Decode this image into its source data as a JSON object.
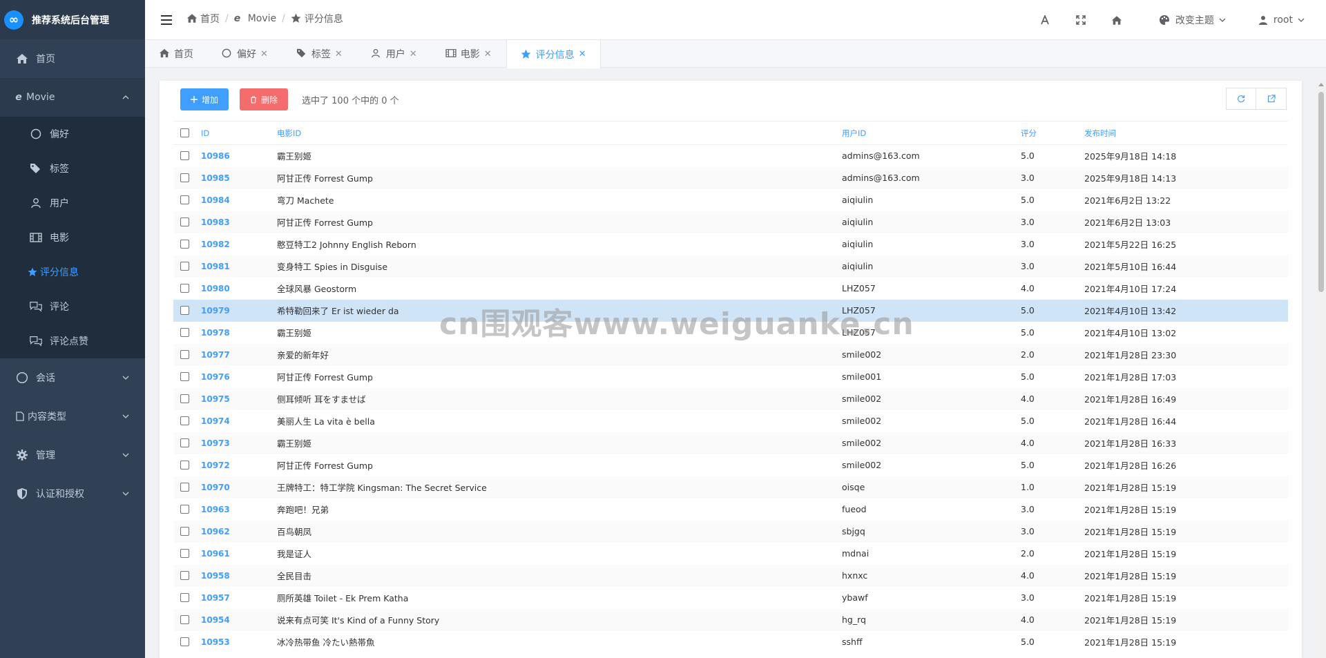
{
  "app": {
    "title": "推荐系统后台管理"
  },
  "sidebar": {
    "home": "首页",
    "movie": "Movie",
    "movie_items": [
      "偏好",
      "标签",
      "用户",
      "电影",
      "评分信息",
      "评论",
      "评论点赞"
    ],
    "session": "会话",
    "content_type": "内容类型",
    "manage": "管理",
    "auth": "认证和授权"
  },
  "header": {
    "breadcrumb": [
      "首页",
      "Movie",
      "评分信息"
    ],
    "theme": "改变主题",
    "user": "root"
  },
  "tabs": [
    "首页",
    "偏好",
    "标签",
    "用户",
    "电影",
    "评分信息"
  ],
  "toolbar": {
    "add": "增加",
    "delete": "删除",
    "selection": "选中了 100 个中的 0 个"
  },
  "table": {
    "headers": [
      "ID",
      "电影ID",
      "用户ID",
      "评分",
      "发布时间"
    ],
    "rows": [
      [
        "10986",
        "霸王别姬",
        "admins@163.com",
        "5.0",
        "2025年9月18日 14:18"
      ],
      [
        "10985",
        "阿甘正传 Forrest Gump",
        "admins@163.com",
        "3.0",
        "2025年9月18日 14:13"
      ],
      [
        "10984",
        "弯刀 Machete",
        "aiqiulin",
        "5.0",
        "2021年6月2日 13:22"
      ],
      [
        "10983",
        "阿甘正传 Forrest Gump",
        "aiqiulin",
        "3.0",
        "2021年6月2日 13:03"
      ],
      [
        "10982",
        "憨豆特工2 Johnny English Reborn",
        "aiqiulin",
        "3.0",
        "2021年5月22日 16:25"
      ],
      [
        "10981",
        "变身特工 Spies in Disguise",
        "aiqiulin",
        "3.0",
        "2021年5月10日 16:44"
      ],
      [
        "10980",
        "全球风暴 Geostorm",
        "LHZ057",
        "4.0",
        "2021年4月10日 17:24"
      ],
      [
        "10979",
        "希特勒回来了 Er ist wieder da",
        "LHZ057",
        "5.0",
        "2021年4月10日 13:42"
      ],
      [
        "10978",
        "霸王别姬",
        "LHZ057",
        "5.0",
        "2021年4月10日 13:02"
      ],
      [
        "10977",
        "亲爱的新年好",
        "smile002",
        "2.0",
        "2021年1月28日 23:30"
      ],
      [
        "10976",
        "阿甘正传 Forrest Gump",
        "smile001",
        "5.0",
        "2021年1月28日 17:03"
      ],
      [
        "10975",
        "侧耳倾听 耳をすませば",
        "smile002",
        "4.0",
        "2021年1月28日 16:49"
      ],
      [
        "10974",
        "美丽人生 La vita è bella",
        "smile002",
        "5.0",
        "2021年1月28日 16:44"
      ],
      [
        "10973",
        "霸王别姬",
        "smile002",
        "4.0",
        "2021年1月28日 16:33"
      ],
      [
        "10972",
        "阿甘正传 Forrest Gump",
        "smile002",
        "5.0",
        "2021年1月28日 16:26"
      ],
      [
        "10970",
        "王牌特工：特工学院 Kingsman: The Secret Service",
        "oisqe",
        "1.0",
        "2021年1月28日 15:19"
      ],
      [
        "10963",
        "奔跑吧！兄弟",
        "fueod",
        "3.0",
        "2021年1月28日 15:19"
      ],
      [
        "10962",
        "百鸟朝凤",
        "sbjgq",
        "3.0",
        "2021年1月28日 15:19"
      ],
      [
        "10961",
        "我是证人",
        "mdnai",
        "2.0",
        "2021年1月28日 15:19"
      ],
      [
        "10958",
        "全民目击",
        "hxnxc",
        "4.0",
        "2021年1月28日 15:19"
      ],
      [
        "10957",
        "厕所英雄 Toilet - Ek Prem Katha",
        "ybawf",
        "3.0",
        "2021年1月28日 15:19"
      ],
      [
        "10954",
        "说来有点可笑 It's Kind of a Funny Story",
        "hg_rq",
        "4.0",
        "2021年1月28日 15:19"
      ],
      [
        "10953",
        "冰冷热带鱼 冷たい熱帯魚",
        "sshff",
        "5.0",
        "2021年1月28日 15:19"
      ]
    ],
    "highlighted_row": 7
  },
  "watermark": "cn围观客www.weiguanke.cn",
  "colors": {
    "sidebar_bg": "#304156",
    "accent": "#409eff",
    "danger": "#f56c6c"
  },
  "icons": [
    "home-icon",
    "ie-icon",
    "star-icon",
    "circle-icon",
    "tag-icon",
    "user-icon",
    "film-icon",
    "comment-icon",
    "file-icon",
    "gear-icon",
    "shield-icon",
    "font-icon",
    "fullscreen-icon",
    "palette-icon",
    "refresh-icon",
    "export-icon"
  ]
}
